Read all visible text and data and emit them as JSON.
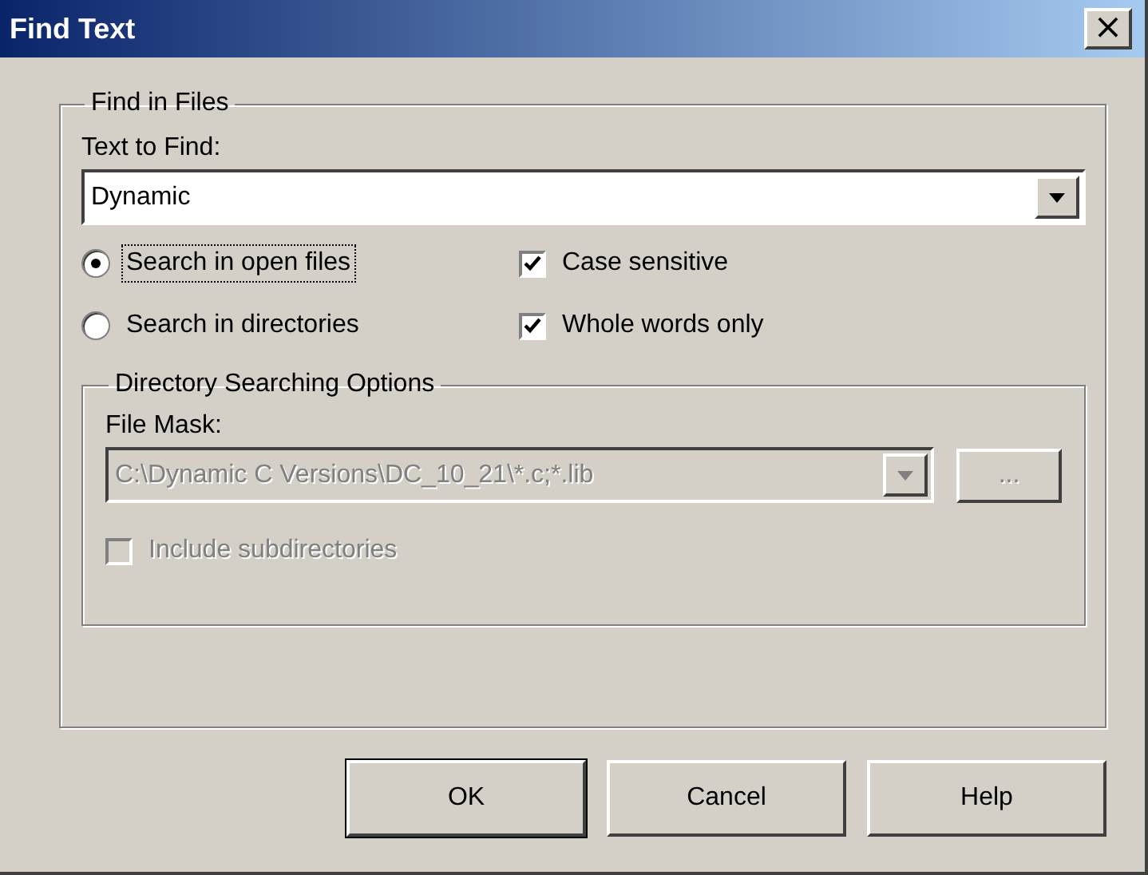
{
  "window": {
    "title": "Find Text",
    "close": "×"
  },
  "find_in_files": {
    "title": "Find in Files",
    "text_label": "Text to Find:",
    "text_value": "Dynamic",
    "scope": [
      {
        "label": "Search in open files",
        "selected": true
      },
      {
        "label": "Search in directories",
        "selected": false
      }
    ],
    "options": [
      {
        "label": "Case sensitive",
        "checked": true
      },
      {
        "label": "Whole words only",
        "checked": true
      }
    ]
  },
  "directory_options": {
    "title": "Directory Searching Options",
    "disabled": true,
    "mask_label": "File Mask:",
    "mask_value": "C:\\Dynamic C Versions\\DC_10_21\\*.c;*.lib",
    "browse": "...",
    "include_subdirectories": {
      "label": "Include subdirectories",
      "checked": false
    }
  },
  "buttons": [
    {
      "label": "OK",
      "default": true
    },
    {
      "label": "Cancel",
      "default": false
    },
    {
      "label": "Help",
      "default": false
    }
  ]
}
